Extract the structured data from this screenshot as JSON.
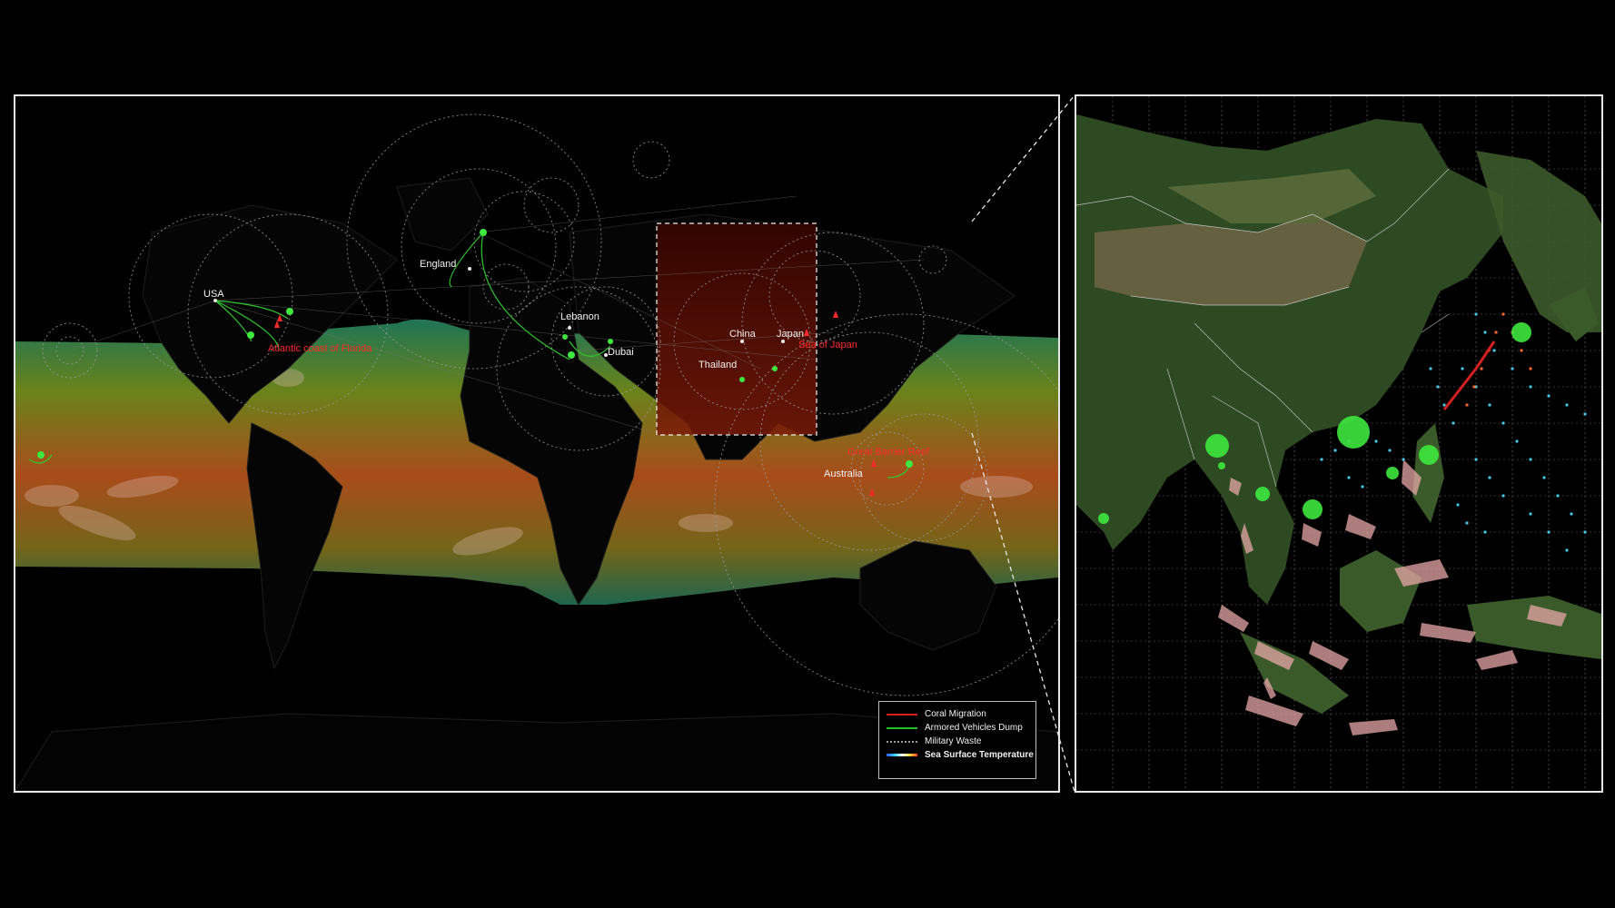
{
  "labels": {
    "usa": "USA",
    "england": "England",
    "lebanon": "Lebanon",
    "dubai": "Dubai",
    "china": "China",
    "thailand": "Thailand",
    "japan": "Japan",
    "australia": "Australia"
  },
  "annotations": {
    "florida": "Atlantic coast of Florida",
    "japan_sea": "Sea of Japan",
    "australia_site": "Great Barrier Reef"
  },
  "legend": {
    "items": [
      {
        "label": "Coral Migration",
        "color": "#d62020"
      },
      {
        "label": "Armored Vehicles Dump",
        "color": "#22c022"
      },
      {
        "label": "Military Waste",
        "color": "#9a9a9a"
      },
      {
        "label": "Sea Surface Temperature",
        "color": "gradient"
      }
    ]
  },
  "colors": {
    "sst_warm": "#c0461e",
    "sst_mid": "#6f8a1c",
    "sst_cool": "#1f7a5a",
    "dump_green": "#3ee83e",
    "route_red": "#ff2a2a",
    "focus_box": "#5a0a05"
  }
}
